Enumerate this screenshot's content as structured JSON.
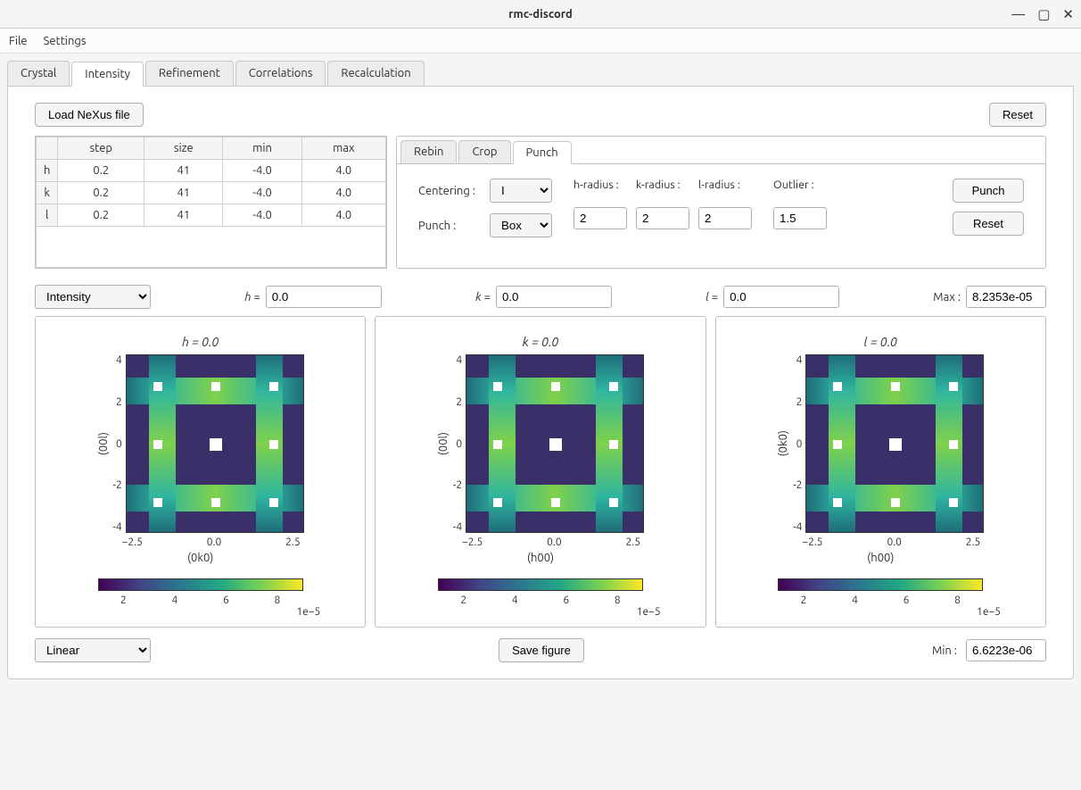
{
  "window": {
    "title": "rmc-discord"
  },
  "menu": {
    "file": "File",
    "settings": "Settings"
  },
  "tabs": {
    "crystal": "Crystal",
    "intensity": "Intensity",
    "refinement": "Refinement",
    "correlations": "Correlations",
    "recalculation": "Recalculation"
  },
  "buttons": {
    "load_nexus": "Load NeXus file",
    "reset": "Reset",
    "punch": "Punch",
    "save_figure": "Save figure"
  },
  "table": {
    "headers": {
      "step": "step",
      "size": "size",
      "min": "min",
      "max": "max"
    },
    "rows": [
      {
        "label": "h",
        "step": "0.2",
        "size": "41",
        "min": "-4.0",
        "max": "4.0"
      },
      {
        "label": "k",
        "step": "0.2",
        "size": "41",
        "min": "-4.0",
        "max": "4.0"
      },
      {
        "label": "l",
        "step": "0.2",
        "size": "41",
        "min": "-4.0",
        "max": "4.0"
      }
    ]
  },
  "subtabs": {
    "rebin": "Rebin",
    "crop": "Crop",
    "punch": "Punch"
  },
  "punch_panel": {
    "centering_label": "Centering :",
    "centering_value": "I",
    "punch_label": "Punch :",
    "punch_value": "Box",
    "h_radius_label": "h-radius :",
    "k_radius_label": "k-radius :",
    "l_radius_label": "l-radius :",
    "h_radius": "2",
    "k_radius": "2",
    "l_radius": "2",
    "outlier_label": "Outlier :",
    "outlier": "1.5"
  },
  "slice": {
    "mode": "Intensity",
    "h_label": "h =",
    "h_value": "0.0",
    "k_label": "k =",
    "k_value": "0.0",
    "l_label": "l =",
    "l_value": "0.0",
    "max_label": "Max :",
    "max_value": "8.2353e-05"
  },
  "scale": {
    "mode": "Linear",
    "min_label": "Min :",
    "min_value": "6.6223e-06"
  },
  "chart_data": [
    {
      "type": "heatmap",
      "title": "h = 0.0",
      "xlabel": "(0k0)",
      "ylabel": "(00l)",
      "xlim": [
        -4,
        4
      ],
      "ylim": [
        -4,
        4
      ],
      "xticks": [
        -2.5,
        0.0,
        2.5
      ],
      "yticks": [
        -4,
        -2,
        0,
        2,
        4
      ],
      "colorbar_ticks": [
        2,
        4,
        6,
        8
      ],
      "colorbar_scale": "1e−5"
    },
    {
      "type": "heatmap",
      "title": "k = 0.0",
      "xlabel": "(h00)",
      "ylabel": "(00l)",
      "xlim": [
        -4,
        4
      ],
      "ylim": [
        -4,
        4
      ],
      "xticks": [
        -2.5,
        0.0,
        2.5
      ],
      "yticks": [
        -4,
        -2,
        0,
        2,
        4
      ],
      "colorbar_ticks": [
        2,
        4,
        6,
        8
      ],
      "colorbar_scale": "1e−5"
    },
    {
      "type": "heatmap",
      "title": "l = 0.0",
      "xlabel": "(h00)",
      "ylabel": "(0k0)",
      "xlim": [
        -4,
        4
      ],
      "ylim": [
        -4,
        4
      ],
      "xticks": [
        -2.5,
        0.0,
        2.5
      ],
      "yticks": [
        -4,
        -2,
        0,
        2,
        4
      ],
      "colorbar_ticks": [
        2,
        4,
        6,
        8
      ],
      "colorbar_scale": "1e−5"
    }
  ]
}
